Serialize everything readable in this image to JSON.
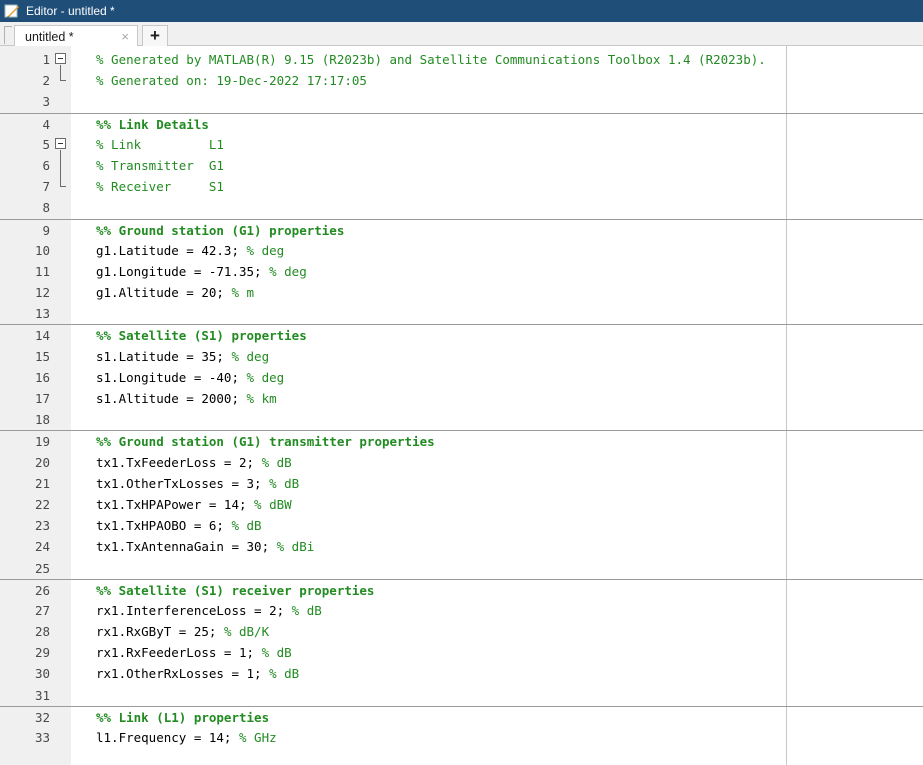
{
  "window": {
    "title": "Editor - untitled *"
  },
  "tabs": [
    {
      "label": "untitled *",
      "close": "×"
    }
  ],
  "tab_add_label": "+",
  "colors": {
    "titlebar": "#1f4e79",
    "comment": "#228b22",
    "gutter": "#f0f0f0"
  },
  "editor": {
    "lines": [
      {
        "n": "1",
        "code": "",
        "comment": "% Generated by MATLAB(R) 9.15 (R2023b) and Satellite Communications Toolbox 1.4 (R2023b)."
      },
      {
        "n": "2",
        "code": "",
        "comment": "% Generated on: 19-Dec-2022 17:17:05"
      },
      {
        "n": "3",
        "code": "",
        "comment": ""
      },
      {
        "n": "4",
        "code": "",
        "comment": "%% Link Details"
      },
      {
        "n": "5",
        "code": "",
        "comment": "% Link         L1"
      },
      {
        "n": "6",
        "code": "",
        "comment": "% Transmitter  G1"
      },
      {
        "n": "7",
        "code": "",
        "comment": "% Receiver     S1"
      },
      {
        "n": "8",
        "code": "",
        "comment": ""
      },
      {
        "n": "9",
        "code": "",
        "comment": "%% Ground station (G1) properties"
      },
      {
        "n": "10",
        "code": "g1.Latitude = 42.3; ",
        "comment": "% deg"
      },
      {
        "n": "11",
        "code": "g1.Longitude = -71.35; ",
        "comment": "% deg"
      },
      {
        "n": "12",
        "code": "g1.Altitude = 20; ",
        "comment": "% m"
      },
      {
        "n": "13",
        "code": "",
        "comment": ""
      },
      {
        "n": "14",
        "code": "",
        "comment": "%% Satellite (S1) properties"
      },
      {
        "n": "15",
        "code": "s1.Latitude = 35; ",
        "comment": "% deg"
      },
      {
        "n": "16",
        "code": "s1.Longitude = -40; ",
        "comment": "% deg"
      },
      {
        "n": "17",
        "code": "s1.Altitude = 2000; ",
        "comment": "% km"
      },
      {
        "n": "18",
        "code": "",
        "comment": ""
      },
      {
        "n": "19",
        "code": "",
        "comment": "%% Ground station (G1) transmitter properties"
      },
      {
        "n": "20",
        "code": "tx1.TxFeederLoss = 2; ",
        "comment": "% dB"
      },
      {
        "n": "21",
        "code": "tx1.OtherTxLosses = 3; ",
        "comment": "% dB"
      },
      {
        "n": "22",
        "code": "tx1.TxHPAPower = 14; ",
        "comment": "% dBW"
      },
      {
        "n": "23",
        "code": "tx1.TxHPAOBO = 6; ",
        "comment": "% dB"
      },
      {
        "n": "24",
        "code": "tx1.TxAntennaGain = 30; ",
        "comment": "% dBi"
      },
      {
        "n": "25",
        "code": "",
        "comment": ""
      },
      {
        "n": "26",
        "code": "",
        "comment": "%% Satellite (S1) receiver properties"
      },
      {
        "n": "27",
        "code": "rx1.InterferenceLoss = 2; ",
        "comment": "% dB"
      },
      {
        "n": "28",
        "code": "rx1.RxGByT = 25; ",
        "comment": "% dB/K"
      },
      {
        "n": "29",
        "code": "rx1.RxFeederLoss = 1; ",
        "comment": "% dB"
      },
      {
        "n": "30",
        "code": "rx1.OtherRxLosses = 1; ",
        "comment": "% dB"
      },
      {
        "n": "31",
        "code": "",
        "comment": ""
      },
      {
        "n": "32",
        "code": "",
        "comment": "%% Link (L1) properties"
      },
      {
        "n": "33",
        "code": "l1.Frequency = 14; ",
        "comment": "% GHz"
      }
    ]
  }
}
